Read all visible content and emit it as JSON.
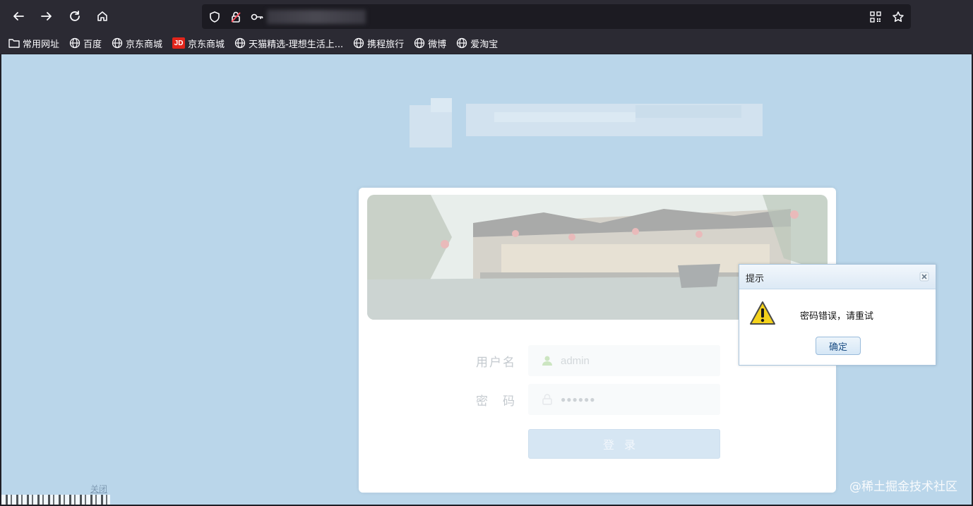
{
  "browser": {
    "bookmarks": [
      {
        "label": "常用网址",
        "icon": "folder-icon"
      },
      {
        "label": "百度",
        "icon": "globe-icon"
      },
      {
        "label": "京东商城",
        "icon": "globe-icon"
      },
      {
        "label": "京东商城",
        "icon": "jd-icon",
        "badge": "JD"
      },
      {
        "label": "天猫精选-理想生活上...",
        "icon": "globe-icon"
      },
      {
        "label": "携程旅行",
        "icon": "globe-icon"
      },
      {
        "label": "微博",
        "icon": "globe-icon"
      },
      {
        "label": "爱淘宝",
        "icon": "globe-icon"
      }
    ]
  },
  "login": {
    "username_label": "用户名",
    "username_value": "admin",
    "password_label": "密　码",
    "password_value": "●●●●●●",
    "submit_label": "登录"
  },
  "dialog": {
    "title": "提示",
    "message": "密码错误，请重试",
    "ok_label": "确定"
  },
  "page": {
    "close_link": "关闭",
    "watermark": "@稀土掘金技术社区"
  },
  "colors": {
    "page_bg": "#bad6ea",
    "chrome_bg": "#2b2a33",
    "dialog_border": "#a8c4dd"
  }
}
